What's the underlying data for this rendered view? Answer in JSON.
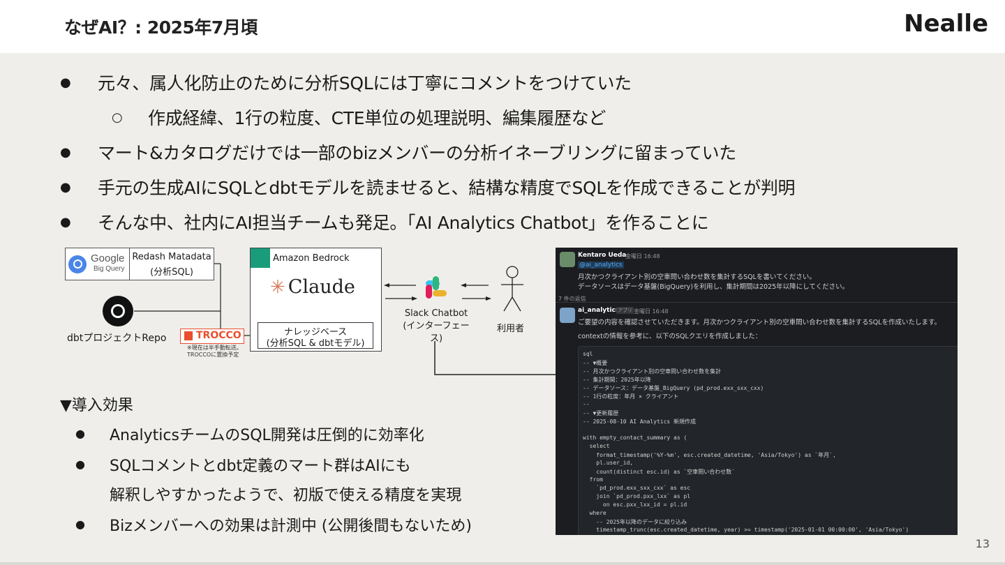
{
  "header": {
    "title": "なぜAI？: 2025年7月頃",
    "logo": "Nealle"
  },
  "bullets": [
    {
      "text": "元々、属人化防止のために分析SQLには丁寧にコメントをつけていた",
      "level": 1
    },
    {
      "text": "作成経緯、1行の粒度、CTE単位の処理説明、編集履歴など",
      "level": 2
    },
    {
      "text": "マート&カタログだけでは一部のbizメンバーの分析イネーブリングに留まっていた",
      "level": 1
    },
    {
      "text": "手元の生成AIにSQLとdbtモデルを読ませると、結構な精度でSQLを作成できることが判明",
      "level": 1
    },
    {
      "text": "そんな中、社内にAI担当チームも発足。「AI Analytics Chatbot」を作ることに",
      "level": 1
    }
  ],
  "bullet_markers": {
    "level1": "●",
    "level2": "○"
  },
  "diagram": {
    "bigquery_label1": "Google",
    "bigquery_label2": "Big Query",
    "redash_line1": "Redash Matadata",
    "redash_line2": "(分析SQL)",
    "dbt_repo": "dbtプロジェクトRepo",
    "trocco": "TROCCO",
    "trocco_note1": "※現在は半手動転送。",
    "trocco_note2": "TROCCOに置換予定",
    "bedrock": "Amazon Bedrock",
    "claude": "Claude",
    "knowledge_line1": "ナレッジベース",
    "knowledge_line2": "(分析SQL & dbtモデル)",
    "slack_line1": "Slack Chatbot",
    "slack_line2": "(インターフェース)",
    "user": "利用者"
  },
  "effects": {
    "title": "▼導入効果",
    "items": [
      {
        "text": "AnalyticsチームのSQL開発は圧倒的に効率化"
      },
      {
        "text": "SQLコメントとdbt定義のマート群はAIにも"
      },
      {
        "text": "解釈しやすかったようで、初版で使える精度を実現",
        "continuation": true
      },
      {
        "text": "Bizメンバーへの効果は計測中 (公開後間もないため)"
      }
    ]
  },
  "slack": {
    "user_name": "Kentaro Ueda",
    "user_time": "金曜日 16:48",
    "mention": "@ai_analytics",
    "user_msg1": "月次かつクライアント別の空車問い合わせ数を集計するSQLを書いてください。",
    "user_msg2": "データソースはデータ基盤(BigQuery)を利用し、集計期間は2025年以降にしてください。",
    "replies": "7 件の返信",
    "bot_name": "ai_analytics",
    "bot_tag": "アプリ",
    "bot_time": "金曜日 16:48",
    "bot_msg1": "ご要望の内容を確認させていただきます。月次かつクライアント別の空車問い合わせ数を集計するSQLを作成いたします。",
    "bot_msg2": "contextの情報を参考に、以下のSQLクエリを作成しました：",
    "code_lines": [
      "sql",
      "-- ▼概要",
      "-- 月次かつクライアント別の空車問い合わせ数を集計",
      "-- 集計期間：2025年以降",
      "-- データソース：データ基盤_BigQuery (pd_prod.exx_sxx_cxx)",
      "-- 1行の粒度：年月 × クライアント",
      "--",
      "-- ▼更新履歴",
      "-- 2025-08-10 AI Analytics 新規作成",
      "",
      "with empty_contact_summary as (",
      "  select",
      "    format_timestamp('%Y-%m', esc.created_datetime, 'Asia/Tokyo') as `年月`,",
      "    pl.user_id,",
      "    count(distinct esc.id) as `空車問い合わせ数`",
      "  from",
      "    `pd_prod.exx_sxx_cxx` as esc",
      "    join `pd_prod.pxx_lxx` as pl",
      "      on esc.pxx_lxx_id = pl.id",
      "  where",
      "    -- 2025年以降のデータに絞り込み",
      "    timestamp_trunc(esc.created_datetime, year) >= timestamp('2025-01-01 00:00:00', 'Asia/Tokyo')"
    ]
  },
  "page_number": "13"
}
